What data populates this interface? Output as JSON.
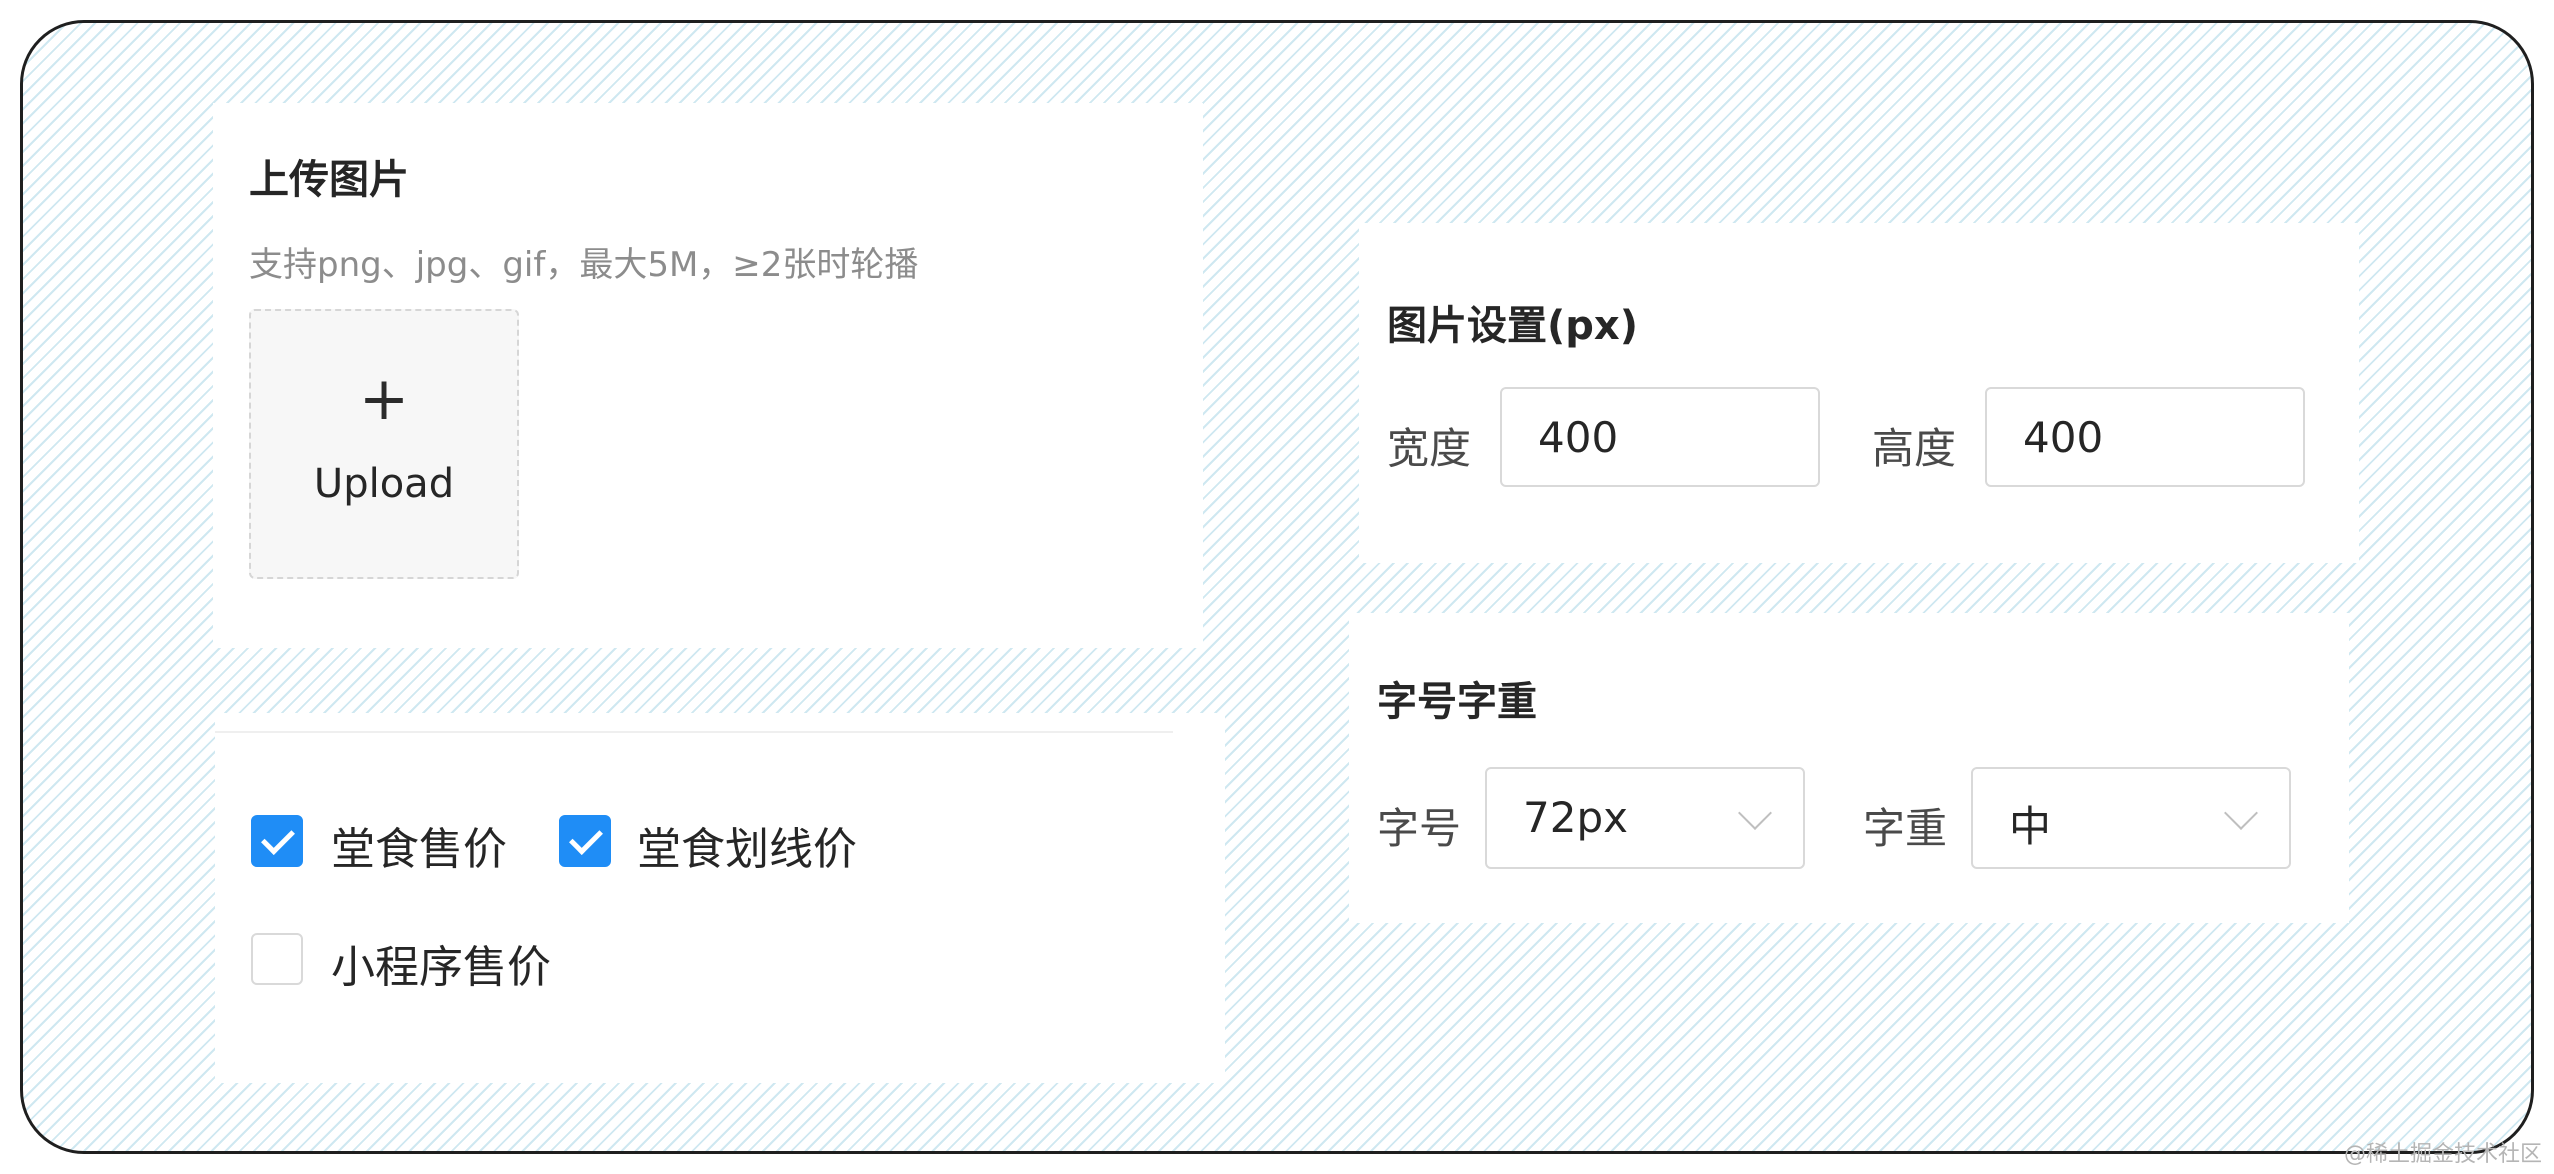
{
  "upload_section": {
    "title": "上传图片",
    "hint": "支持png、jpg、gif，最大5M，≥2张时轮播",
    "upload_icon": "plus-icon",
    "upload_label": "Upload"
  },
  "price_section": {
    "options": [
      {
        "label": "堂食售价",
        "checked": true
      },
      {
        "label": "堂食划线价",
        "checked": true
      },
      {
        "label": "小程序售价",
        "checked": false
      }
    ]
  },
  "image_settings": {
    "title": "图片设置(px)",
    "width_label": "宽度",
    "width_value": "400",
    "height_label": "高度",
    "height_value": "400"
  },
  "font_settings": {
    "title": "字号字重",
    "size_label": "字号",
    "size_value": "72px",
    "weight_label": "字重",
    "weight_value": "中"
  },
  "watermark": "@稀土掘金技术社区",
  "colors": {
    "accent": "#1f8df6",
    "stripe": "#cfe8f1"
  }
}
